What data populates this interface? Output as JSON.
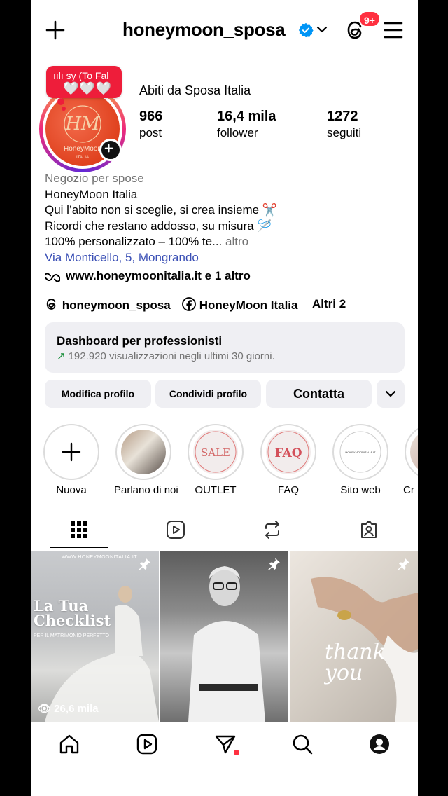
{
  "header": {
    "username": "honeymoon_sposa",
    "notification_badge": "9+"
  },
  "profile": {
    "note_song": "sy (To Fal",
    "note_hearts": "🤍🤍🤍",
    "display_name": "Abiti da Sposa Italia",
    "avatar_text": "HoneyMoon",
    "avatar_subtext": "ITALIA",
    "stats": [
      {
        "value": "966",
        "label": "post"
      },
      {
        "value": "16,4 mila",
        "label": "follower"
      },
      {
        "value": "1272",
        "label": "seguiti"
      }
    ]
  },
  "bio": {
    "category": "Negozio per spose",
    "line1": "HoneyMoon Italia",
    "line2": "Qui l’abito non si sceglie, si crea insieme ✂️",
    "line3": "Ricordi che restano addosso, su misura 🪡",
    "line4": "100% personalizzato – 100% te...",
    "more": "altro",
    "address": "Via Monticello, 5, Mongrando",
    "link": "www.honeymoonitalia.it e 1 altro"
  },
  "social": {
    "threads": "honeymoon_sposa",
    "facebook": "HoneyMoon Italia",
    "others": "Altri 2"
  },
  "dashboard": {
    "title": "Dashboard per professionisti",
    "subtitle": "192.920 visualizzazioni negli ultimi 30 giorni."
  },
  "buttons": {
    "edit": "Modifica profilo",
    "share": "Condividi profilo",
    "contact": "Contatta"
  },
  "highlights": [
    {
      "label": "Nuova"
    },
    {
      "label": "Parlano di noi"
    },
    {
      "label": "OUTLET",
      "cover": "SALE"
    },
    {
      "label": "FAQ",
      "cover": "FAQ"
    },
    {
      "label": "Sito web",
      "cover": "HONEYMOONITALIA.IT"
    },
    {
      "label": "Cr"
    }
  ],
  "grid": [
    {
      "site": "WWW.HONEYMOONITALIA.IT",
      "title": "La Tua Checklist",
      "subtitle": "PER IL MATRIMONIO PERFETTO",
      "views": "26,6 mila"
    },
    {},
    {
      "script": "thank you"
    }
  ],
  "colors": {
    "accent_red": "#ff3040",
    "verified_blue": "#0095f6",
    "address_blue": "#3a4fb5",
    "secondary_text": "#737373",
    "panel_gray": "#efeff3"
  }
}
